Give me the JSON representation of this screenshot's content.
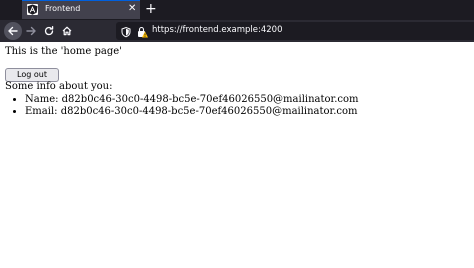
{
  "browser": {
    "tab": {
      "title": "Frontend",
      "favicon": "angular-icon"
    },
    "new_tab_icon": "plus-icon",
    "url": "https://frontend.example:4200",
    "colors": {
      "chrome_dark": "#1c1b22",
      "toolbar": "#2b2a33",
      "tab_active": "#42414d",
      "tab_accent": "#0060df",
      "text_light": "#fbfbfe",
      "warning": "#ffbf00"
    }
  },
  "page": {
    "home_text": "This is the 'home page'",
    "logout_label": "Log out",
    "info_heading": "Some info about you:",
    "info": [
      {
        "label": "Name: d82b0c46-30c0-4498-bc5e-70ef46026550@mailinator.com"
      },
      {
        "label": "Email: d82b0c46-30c0-4498-bc5e-70ef46026550@mailinator.com"
      }
    ]
  }
}
